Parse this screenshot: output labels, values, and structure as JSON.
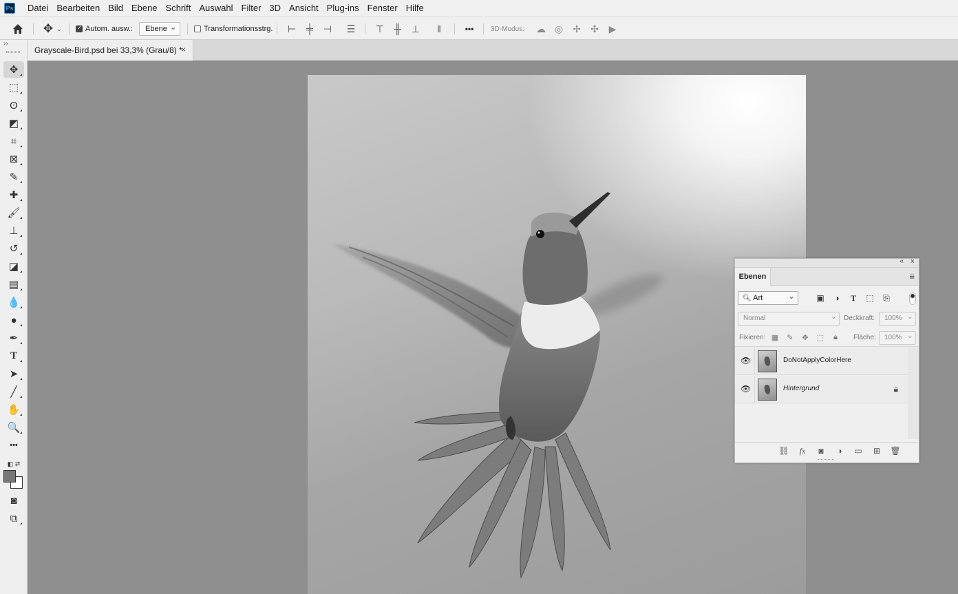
{
  "app": {
    "logo_text": "Ps",
    "menu": [
      "Datei",
      "Bearbeiten",
      "Bild",
      "Ebene",
      "Schrift",
      "Auswahl",
      "Filter",
      "3D",
      "Ansicht",
      "Plug-ins",
      "Fenster",
      "Hilfe"
    ]
  },
  "options_bar": {
    "auto_select_label": "Autom. ausw.:",
    "auto_select_checked": true,
    "auto_select_target": "Ebene",
    "transform_controls_label": "Transformationsstrg.",
    "transform_controls_checked": false,
    "more_icon": "•••",
    "mode_3d_label": "3D-Modus:"
  },
  "document_tab": {
    "title": "Grayscale-Bird.psd bei 33,3% (Grau/8) *",
    "close": "×"
  },
  "toolbar": {
    "collapse_icon": "››",
    "tools": [
      {
        "name": "move-tool",
        "glyph": "✥",
        "active": true
      },
      {
        "name": "rectangular-marquee-tool",
        "glyph": "⬚"
      },
      {
        "name": "lasso-tool",
        "glyph": "ʘ"
      },
      {
        "name": "object-selection-tool",
        "glyph": "◩"
      },
      {
        "name": "crop-tool",
        "glyph": "⌗"
      },
      {
        "name": "frame-tool",
        "glyph": "⊠"
      },
      {
        "name": "eyedropper-tool",
        "glyph": "✎"
      },
      {
        "name": "spot-healing-brush-tool",
        "glyph": "✚"
      },
      {
        "name": "brush-tool",
        "glyph": "🖌"
      },
      {
        "name": "clone-stamp-tool",
        "glyph": "⊥"
      },
      {
        "name": "history-brush-tool",
        "glyph": "↺"
      },
      {
        "name": "eraser-tool",
        "glyph": "◪"
      },
      {
        "name": "gradient-tool",
        "glyph": "▤"
      },
      {
        "name": "blur-tool",
        "glyph": "💧"
      },
      {
        "name": "dodge-tool",
        "glyph": "●"
      },
      {
        "name": "pen-tool",
        "glyph": "✒"
      },
      {
        "name": "type-tool",
        "glyph": "T"
      },
      {
        "name": "path-selection-tool",
        "glyph": "➤"
      },
      {
        "name": "line-tool",
        "glyph": "╱"
      },
      {
        "name": "hand-tool",
        "glyph": "✋"
      },
      {
        "name": "zoom-tool",
        "glyph": "🔍"
      },
      {
        "name": "edit-toolbar",
        "glyph": "•••"
      }
    ],
    "foreground_color": "#777777",
    "background_color": "#ffffff"
  },
  "layers_panel": {
    "tab_label": "Ebenen",
    "filter_kind": "Art",
    "blend_mode": "Normal",
    "opacity_label": "Deckkraft:",
    "opacity_value": "100%",
    "lock_label": "Fixieren:",
    "fill_label": "Fläche:",
    "fill_value": "100%",
    "layers": [
      {
        "name": "DoNotApplyColorHere",
        "visible": true,
        "locked": false,
        "italic": false
      },
      {
        "name": "Hintergrund",
        "visible": true,
        "locked": true,
        "italic": true
      }
    ]
  }
}
